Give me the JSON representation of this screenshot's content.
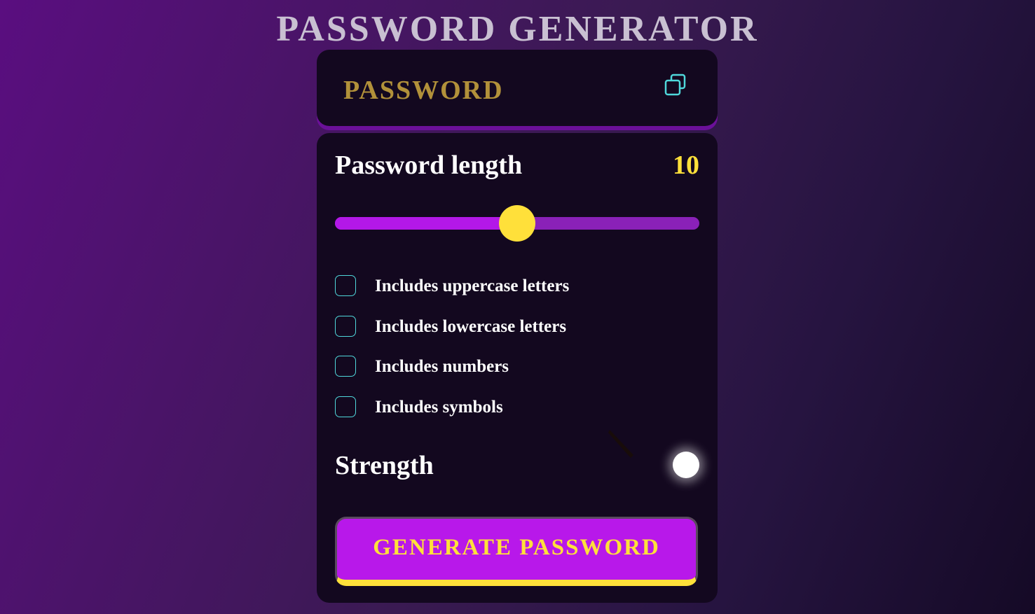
{
  "header": {
    "title": "PASSWORD GENERATOR"
  },
  "display": {
    "password_text": "PASSWORD",
    "copy_icon": "copy-icon"
  },
  "length": {
    "label": "Password length",
    "value": "10",
    "slider_fraction": 0.5
  },
  "options": [
    {
      "label": "Includes uppercase letters",
      "checked": false
    },
    {
      "label": "Includes lowercase letters",
      "checked": false
    },
    {
      "label": "Includes numbers",
      "checked": false
    },
    {
      "label": "Includes symbols",
      "checked": false
    }
  ],
  "strength": {
    "label": "Strength"
  },
  "actions": {
    "generate_label": "GENERATE PASSWORD"
  },
  "colors": {
    "accent": "#b818ea",
    "highlight": "#ffe03a",
    "checkbox_border": "#4fd7da",
    "panel": "#13081f",
    "display_text": "#b2913a"
  }
}
